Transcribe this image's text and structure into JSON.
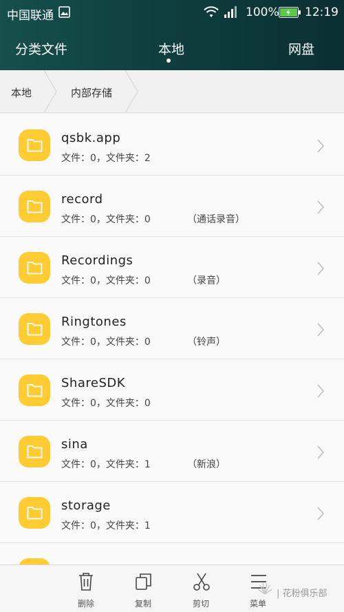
{
  "status_bar": {
    "carrier": "中国联通",
    "battery": "100%",
    "time": "12:19"
  },
  "tabs": [
    {
      "label": "分类文件"
    },
    {
      "label": "本地"
    },
    {
      "label": "网盘"
    }
  ],
  "breadcrumb": [
    "本地",
    "内部存储"
  ],
  "files": [
    {
      "name": "qsbk.app",
      "meta": "文件：0，文件夹：2",
      "note": ""
    },
    {
      "name": "record",
      "meta": "文件：0，文件夹：0",
      "note": "（通话录音）"
    },
    {
      "name": "Recordings",
      "meta": "文件：0，文件夹：0",
      "note": "（录音）"
    },
    {
      "name": "Ringtones",
      "meta": "文件：0，文件夹：0",
      "note": "（铃声）"
    },
    {
      "name": "ShareSDK",
      "meta": "文件：0，文件夹：0",
      "note": ""
    },
    {
      "name": "sina",
      "meta": "文件：0，文件夹：1",
      "note": "（新浪）"
    },
    {
      "name": "storage",
      "meta": "文件：0，文件夹：1",
      "note": ""
    }
  ],
  "bottom_actions": [
    {
      "label": "删除",
      "icon": "trash-icon"
    },
    {
      "label": "复制",
      "icon": "copy-icon"
    },
    {
      "label": "剪切",
      "icon": "scissors-icon"
    },
    {
      "label": "菜单",
      "icon": "menu-icon"
    }
  ],
  "watermark": "| 花粉俱乐部",
  "colors": {
    "header": "#0e3f3e",
    "folder": "#ffcc33",
    "background": "#fafafa"
  }
}
